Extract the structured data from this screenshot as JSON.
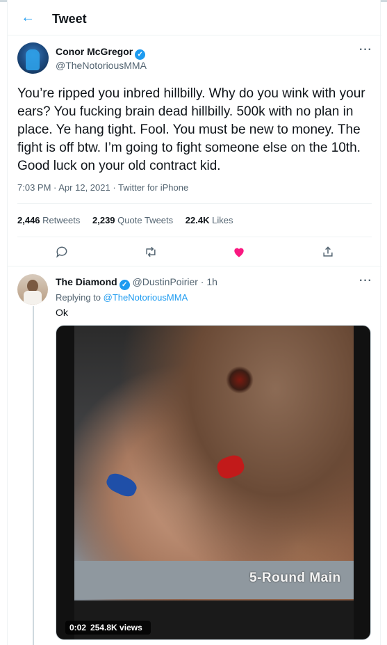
{
  "header": {
    "title": "Tweet"
  },
  "tweet": {
    "author_name": "Conor McGregor",
    "author_handle": "@TheNotoriousMMA",
    "text": "You’re ripped you inbred hillbilly. Why do you wink with your ears? You fucking brain dead hillbilly. 500k with no plan in place. Ye hang tight. Fool. You must be new to money. The fight is off btw. I’m going to fight someone else on the 10th. Good luck on your old contract kid.",
    "time": "7:03 PM",
    "date": "Apr 12, 2021",
    "source": "Twitter for iPhone",
    "stats": {
      "retweets_count": "2,446",
      "retweets_label": "Retweets",
      "quotes_count": "2,239",
      "quotes_label": "Quote Tweets",
      "likes_count": "22.4K",
      "likes_label": "Likes"
    },
    "liked": true
  },
  "reply": {
    "author_name": "The Diamond",
    "author_handle": "@DustinPoirier",
    "age": "1h",
    "replying_prefix": "Replying to",
    "replying_to": "@TheNotoriousMMA",
    "text": "Ok",
    "video": {
      "overlay_text": "5-Round Main",
      "duration": "0:02",
      "views": "254.8K views"
    }
  },
  "colors": {
    "accent": "#1d9bf0",
    "like": "#f91880",
    "secondary_text": "#536471"
  },
  "icons": {
    "back": "arrow-left-icon",
    "more": "more-dots-icon",
    "reply": "reply-icon",
    "retweet": "retweet-icon",
    "like": "heart-icon",
    "share": "share-icon",
    "verified": "verified-badge-icon"
  }
}
